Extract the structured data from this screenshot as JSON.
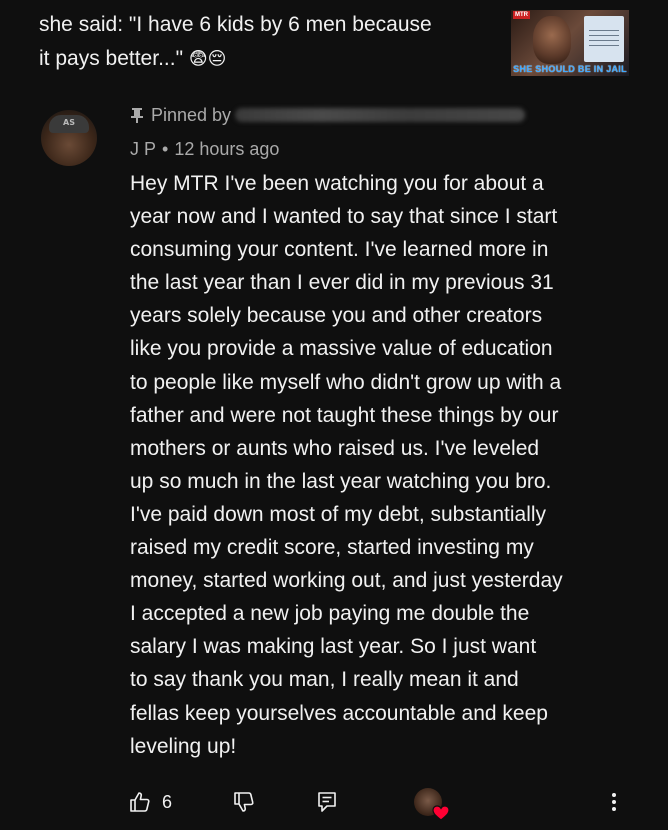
{
  "video": {
    "title_line1": "she said: \"I have 6 kids by 6 men because",
    "title_line2": "it pays better...\"",
    "title_emojis": "😨😔",
    "thumbnail_badge": "MTR",
    "thumbnail_caption": "SHE SHOULD BE IN JAIL"
  },
  "comment": {
    "pinned_label": "Pinned by",
    "author": "J P",
    "separator": "•",
    "time": "12 hours ago",
    "lines": [
      "Hey MTR I've been watching you for about a",
      "year now and I wanted to say that since I start",
      "consuming your content. I've learned more in",
      "the last year than I ever did in my previous 31",
      "years solely because you and other creators",
      "like you provide a massive value of education",
      "to people like myself who didn't grow up with a",
      "father and were not taught these things by our",
      "mothers or aunts who raised us. I've leveled",
      "up so much in the last year watching you bro.",
      "I've paid down most of my debt, substantially",
      "raised my credit score, started investing my",
      "money, started working out, and just yesterday",
      "I accepted a new job paying me double the",
      "salary I was making last year. So I just want",
      "to say thank you man, I really mean it and",
      "fellas keep yourselves accountable and keep",
      "leveling up!"
    ],
    "like_count": "6"
  },
  "icons": {
    "like": "thumbs-up-icon",
    "dislike": "thumbs-down-icon",
    "reply": "comment-reply-icon",
    "creator_heart": "creator-heart-icon",
    "more": "more-vertical-icon",
    "pin": "pin-icon"
  },
  "colors": {
    "background": "#0f0f0f",
    "text": "#f1f1f1",
    "secondary_text": "#aaaaaa",
    "heart": "#ff0033"
  }
}
